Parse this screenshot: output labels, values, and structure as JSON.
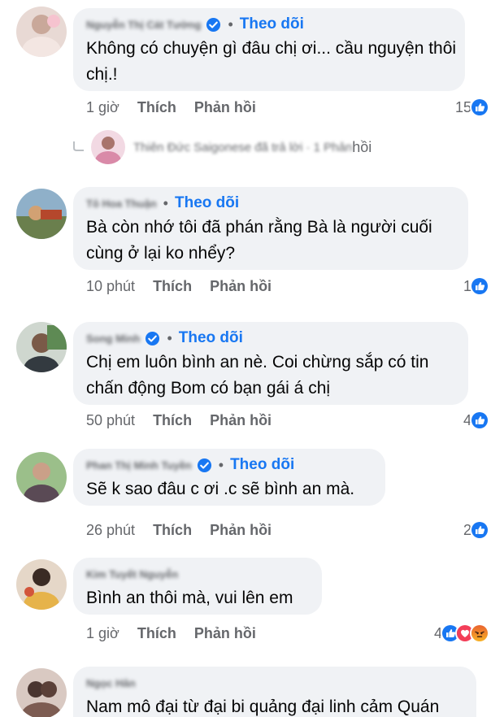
{
  "follow_label": "Theo dõi",
  "like_label": "Thích",
  "reply_label": "Phản hồi",
  "comments": [
    {
      "author": "Nguyễn Thị Cát Tường",
      "verified": true,
      "text": "Không có chuyện gì đâu chị ơi... cầu nguyện thôi chị.!",
      "time": "1 giờ",
      "reaction_count": "15",
      "reactions": [
        "like-icon"
      ]
    },
    {
      "author": "Tô Hoa Thuận",
      "verified": false,
      "text": "Bà còn nhớ tôi đã phán rằng Bà là người cuối cùng ở lại ko nhểy?",
      "time": "10 phút",
      "reaction_count": "1",
      "reactions": [
        "like-icon"
      ]
    },
    {
      "author": "Song Minh",
      "verified": true,
      "text": "Chị em luôn bình an nè. Coi chừng sắp có tin chấn động Bom có bạn gái á chị",
      "time": "50 phút",
      "reaction_count": "4",
      "reactions": [
        "like-icon"
      ]
    },
    {
      "author": "Phan Thị Minh Tuyền",
      "verified": true,
      "text": "Sẽ k sao đâu c ơi .c sẽ bình an mà.",
      "time": "26 phút",
      "reaction_count": "2",
      "reactions": [
        "like-icon"
      ]
    },
    {
      "author": "Kim Tuyết Nguyễn",
      "verified": false,
      "text": "Bình an thôi mà, vui lên em",
      "time": "1 giờ",
      "reaction_count": "4",
      "reactions": [
        "like-icon",
        "love-icon",
        "angry-icon"
      ]
    },
    {
      "author": "Ngọc Hân",
      "verified": false,
      "text": "Nam mô đại từ đại bi quảng đại linh cảm Quán"
    }
  ],
  "reply_thread": {
    "label": "Thiên Đức Saigonese đã trả lời · 1 Phản",
    "label_end": "hồi"
  },
  "colors": {
    "accent": "#1877f2",
    "bubble": "#f0f2f5",
    "muted": "#65676b"
  }
}
